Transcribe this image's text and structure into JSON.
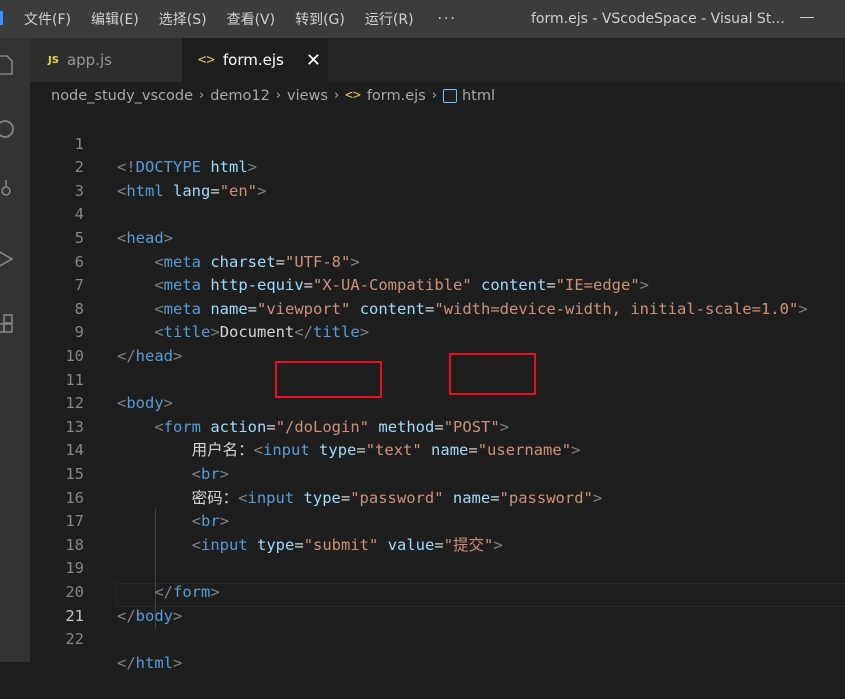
{
  "menu": {
    "items": [
      "文件(F)",
      "编辑(E)",
      "选择(S)",
      "查看(V)",
      "转到(G)",
      "运行(R)"
    ],
    "more": "···"
  },
  "window_title": "form.ejs - VScodeSpace - Visual St...",
  "tabs": [
    {
      "badge": "JS",
      "label": "app.js",
      "active": false
    },
    {
      "badge": "<>",
      "label": "form.ejs",
      "active": true,
      "close": "✕"
    }
  ],
  "breadcrumb": [
    "node_study_vscode",
    "demo12",
    "views",
    "form.ejs",
    "html"
  ],
  "breadcrumb_separator": "›",
  "editor": {
    "active_line": 21,
    "lines": [
      {
        "n": "1"
      },
      {
        "n": "2"
      },
      {
        "n": "3"
      },
      {
        "n": "4"
      },
      {
        "n": "5"
      },
      {
        "n": "6"
      },
      {
        "n": "7"
      },
      {
        "n": "8"
      },
      {
        "n": "9"
      },
      {
        "n": "10"
      },
      {
        "n": "11"
      },
      {
        "n": "12"
      },
      {
        "n": "13"
      },
      {
        "n": "14"
      },
      {
        "n": "15"
      },
      {
        "n": "16"
      },
      {
        "n": "17"
      },
      {
        "n": "18"
      },
      {
        "n": "19"
      },
      {
        "n": "20"
      },
      {
        "n": "21"
      },
      {
        "n": "22"
      }
    ],
    "tokens": {
      "doctype": "DOCTYPE",
      "html": "html",
      "lang": "lang",
      "en": "\"en\"",
      "head": "head",
      "meta": "meta",
      "charset": "charset",
      "utf8": "\"UTF-8\"",
      "http_equiv": "http-equiv",
      "xua": "\"X-UA-Compatible\"",
      "content": "content",
      "ieedge": "\"IE=edge\"",
      "name": "name",
      "viewport": "\"viewport\"",
      "vp_content": "\"width=device-width, initial-scale=1.0\"",
      "title": "title",
      "document": "Document",
      "body": "body",
      "form": "form",
      "action": "action",
      "dologin": "\"/doLogin\"",
      "method": "method",
      "post": "\"POST\"",
      "username_label": "用户名：",
      "input": "input",
      "type": "type",
      "text": "\"text\"",
      "username": "\"username\"",
      "br": "br",
      "password_label": "密码：",
      "password": "\"password\"",
      "submit": "\"submit\"",
      "value": "value",
      "submit_value": "\"提交\""
    }
  },
  "colors": {
    "tag": "#569cd6",
    "attribute": "#9cdcfe",
    "string": "#ce9178",
    "highlight_box": "#e81123"
  },
  "icons": [
    "files-icon",
    "search-icon",
    "source-control-icon",
    "run-debug-icon",
    "extensions-icon"
  ]
}
